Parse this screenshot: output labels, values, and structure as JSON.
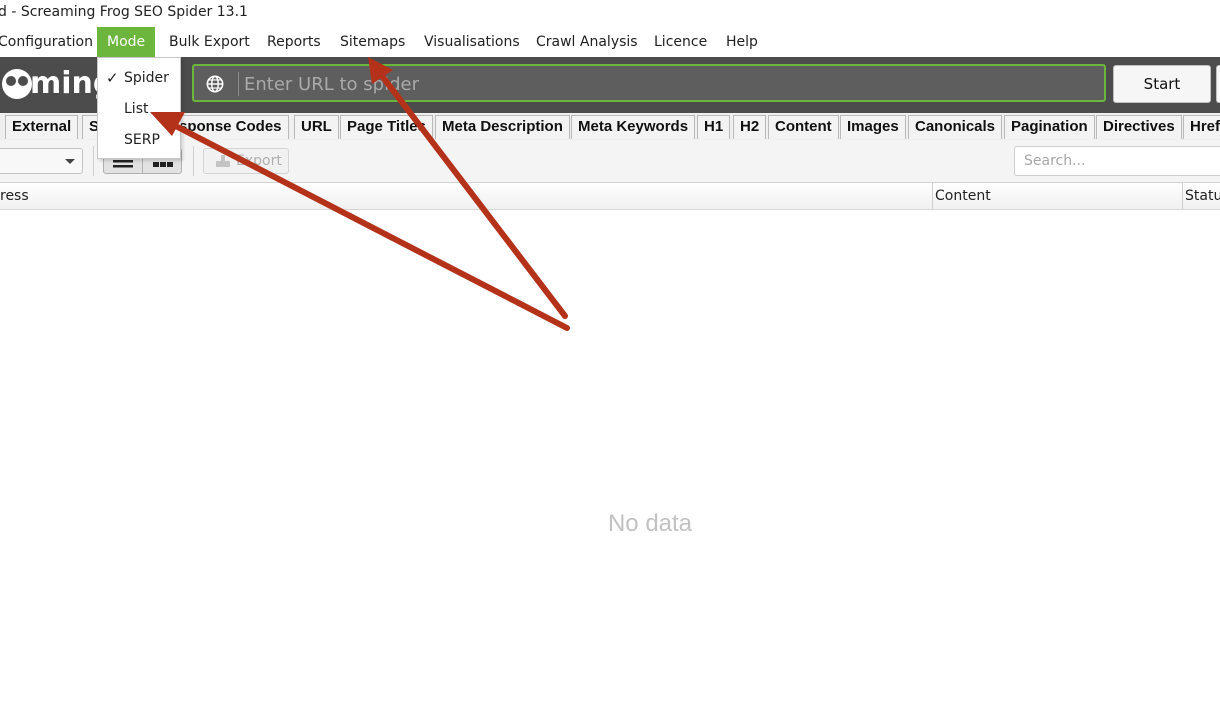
{
  "window": {
    "title": "d - Screaming Frog SEO Spider 13.1"
  },
  "menubar": {
    "items": [
      {
        "label": "Configuration",
        "active": false
      },
      {
        "label": "Mode",
        "active": true
      },
      {
        "label": "Bulk Export",
        "active": false
      },
      {
        "label": "Reports",
        "active": false
      },
      {
        "label": "Sitemaps",
        "active": false
      },
      {
        "label": "Visualisations",
        "active": false
      },
      {
        "label": "Crawl Analysis",
        "active": false
      },
      {
        "label": "Licence",
        "active": false
      },
      {
        "label": "Help",
        "active": false
      }
    ]
  },
  "mode_menu": {
    "items": [
      {
        "label": "Spider",
        "checked": true,
        "check_glyph": "✓"
      },
      {
        "label": "List",
        "checked": false,
        "check_glyph": ""
      },
      {
        "label": "SERP",
        "checked": false,
        "check_glyph": ""
      }
    ]
  },
  "header": {
    "logo_text": "ming",
    "url_placeholder": "Enter URL to spider",
    "start_label": "Start"
  },
  "tabs": [
    {
      "label": "External"
    },
    {
      "label": "S"
    },
    {
      "label": "sponse Codes"
    },
    {
      "label": "URL"
    },
    {
      "label": "Page Titles"
    },
    {
      "label": "Meta Description"
    },
    {
      "label": "Meta Keywords"
    },
    {
      "label": "H1"
    },
    {
      "label": "H2"
    },
    {
      "label": "Content"
    },
    {
      "label": "Images"
    },
    {
      "label": "Canonicals"
    },
    {
      "label": "Pagination"
    },
    {
      "label": "Directives"
    },
    {
      "label": "Href"
    }
  ],
  "toolbar": {
    "export_label": "Export",
    "search_placeholder": "Search..."
  },
  "grid": {
    "columns": [
      "ress",
      "Content",
      "Statu"
    ],
    "empty_message": "No data"
  },
  "colors": {
    "accent_green": "#6cb63e",
    "header_dark": "#4c4c4c",
    "annotation_arrow": "#b5321a"
  },
  "icons": {
    "globe": "globe-icon",
    "list_view": "list-view-icon",
    "tree_view": "tree-view-icon",
    "export": "export-icon",
    "dropdown_caret": "chevron-down-icon",
    "logo": "frog-logo-icon"
  }
}
